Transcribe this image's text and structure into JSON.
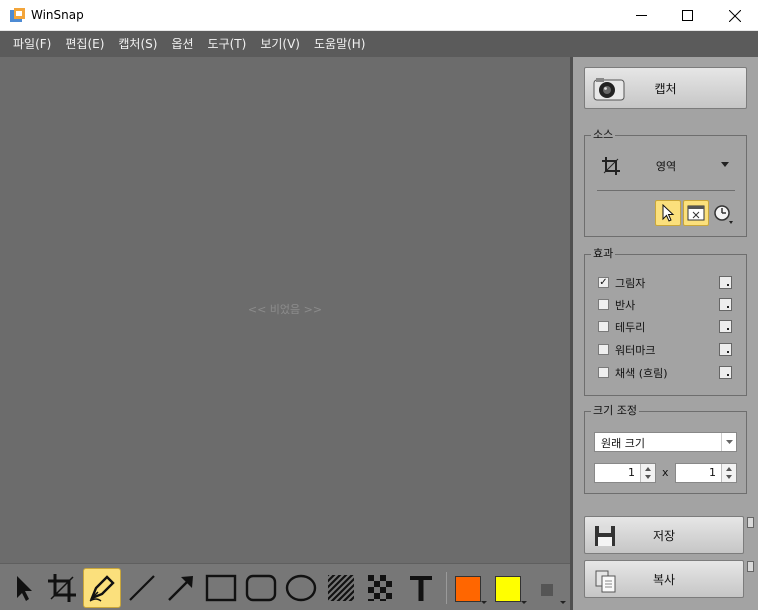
{
  "window": {
    "title": "WinSnap",
    "icon": "winsnap-app-icon",
    "controls": [
      "minimize-icon",
      "maximize-icon",
      "close-icon"
    ]
  },
  "menu": [
    "파일(F)",
    "편집(E)",
    "캡처(S)",
    "옵션",
    "도구(T)",
    "보기(V)",
    "도움말(H)"
  ],
  "canvas": {
    "empty_text": "<< 비었음 >>"
  },
  "toolbar": {
    "tools": [
      {
        "name": "select-tool",
        "icon": "arrow-pointer-icon",
        "active": false
      },
      {
        "name": "crop-tool",
        "icon": "crop-icon",
        "active": false
      },
      {
        "name": "pen-tool",
        "icon": "pen-icon",
        "active": true
      },
      {
        "name": "line-tool",
        "icon": "line-icon",
        "active": false
      },
      {
        "name": "arrow-tool",
        "icon": "arrow-icon",
        "active": false
      },
      {
        "name": "rectangle-tool",
        "icon": "rectangle-icon",
        "active": false
      },
      {
        "name": "rounded-rectangle-tool",
        "icon": "rounded-rectangle-icon",
        "active": false
      },
      {
        "name": "ellipse-tool",
        "icon": "ellipse-icon",
        "active": false
      },
      {
        "name": "hatch-tool",
        "icon": "hatch-icon",
        "active": false
      },
      {
        "name": "pixelate-tool",
        "icon": "checker-icon",
        "active": false
      },
      {
        "name": "text-tool",
        "icon": "text-icon",
        "active": false
      }
    ],
    "colors": {
      "primary": "#ff6600",
      "secondary": "#ffff00",
      "size": "#555555"
    }
  },
  "panel": {
    "capture_label": "캡처",
    "source": {
      "title": "소스",
      "mode": "영역",
      "buttons": [
        "cursor-icon",
        "window-icon",
        "add-timer-icon"
      ]
    },
    "effects": {
      "title": "효과",
      "items": [
        {
          "label": "그림자",
          "checked": true
        },
        {
          "label": "반사",
          "checked": false
        },
        {
          "label": "테두리",
          "checked": false
        },
        {
          "label": "워터마크",
          "checked": false
        },
        {
          "label": "채색 (흐림)",
          "checked": false
        }
      ]
    },
    "resize": {
      "title": "크기 조정",
      "mode": "원래 크기",
      "width": "1",
      "x_sep": "x",
      "height": "1"
    },
    "save_label": "저장",
    "copy_label": "복사"
  }
}
